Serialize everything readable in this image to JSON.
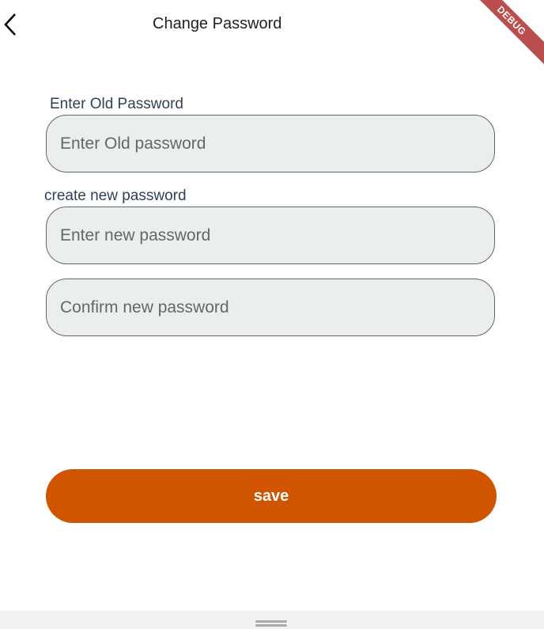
{
  "header": {
    "title": "Change Password",
    "debug_banner": "DEBUG"
  },
  "form": {
    "old_label": "Enter Old Password",
    "old_placeholder": "Enter Old password",
    "new_label": "create new password",
    "new_placeholder": "Enter new password",
    "confirm_placeholder": "Confirm new password",
    "save_label": "save"
  },
  "colors": {
    "accent": "#d15400",
    "field_bg": "#ebeeef",
    "label": "#2f4156"
  }
}
